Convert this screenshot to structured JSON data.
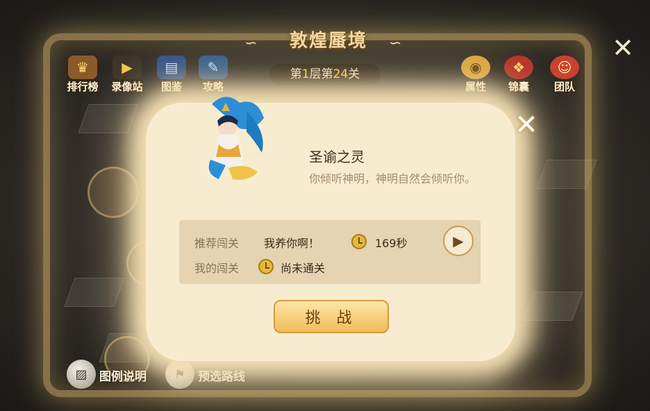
{
  "map": {
    "title": "敦煌蜃境",
    "level_prefix": "第",
    "level_floor": "1",
    "level_mid": "层第",
    "level_stage": "24",
    "level_suffix": "关"
  },
  "top_left_buttons": [
    {
      "label": "排行榜",
      "icon": "trophy-icon"
    },
    {
      "label": "录像站",
      "icon": "camera-icon"
    },
    {
      "label": "图鉴",
      "icon": "book-icon"
    },
    {
      "label": "攻略",
      "icon": "guide-icon"
    }
  ],
  "top_right_buttons": [
    {
      "label": "属性",
      "icon": "attribute-icon"
    },
    {
      "label": "锦囊",
      "icon": "pouch-icon"
    },
    {
      "label": "团队",
      "icon": "team-icon"
    }
  ],
  "bottom_buttons": [
    {
      "label": "图例说明",
      "icon": "legend-icon"
    },
    {
      "label": "预选路线",
      "icon": "flag-icon"
    }
  ],
  "dialog": {
    "name": "圣谕之灵",
    "description": "你倾听神明，神明自然会倾听你。",
    "recommended_label": "推荐闯关",
    "recommended_player": "我养你啊！",
    "recommended_time": "169秒",
    "my_label": "我的闯关",
    "my_status": "尚未通关",
    "challenge_label": "挑 战"
  },
  "colors": {
    "dialog_bg": "#f8ecd0",
    "panel_bg": "#e5d3b1",
    "button_gold": "#f0bd5c",
    "highlight": "#ffd24a"
  }
}
